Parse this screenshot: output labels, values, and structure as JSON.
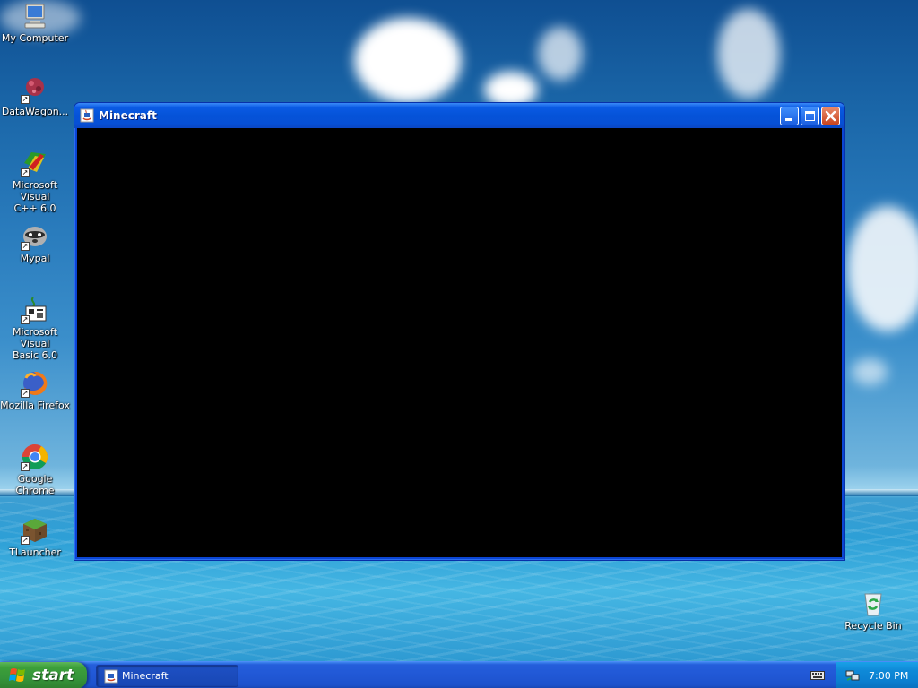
{
  "desktop": {
    "icons": [
      {
        "label": "My Computer",
        "icon": "my-computer-icon",
        "shortcut": false
      },
      {
        "label": "DataWagon...",
        "icon": "datawagon-icon",
        "shortcut": true
      },
      {
        "label": "Microsoft Visual\nC++ 6.0",
        "icon": "visual-cpp-icon",
        "shortcut": true
      },
      {
        "label": "Mypal",
        "icon": "mypal-icon",
        "shortcut": true
      },
      {
        "label": "Microsoft Visual\nBasic 6.0",
        "icon": "visual-basic-icon",
        "shortcut": true
      },
      {
        "label": "Mozilla Firefox",
        "icon": "firefox-icon",
        "shortcut": true
      },
      {
        "label": "Google Chrome",
        "icon": "chrome-icon",
        "shortcut": true
      },
      {
        "label": "TLauncher",
        "icon": "tlauncher-icon",
        "shortcut": true
      }
    ],
    "recycle_bin": {
      "label": "Recycle Bin",
      "icon": "recycle-bin-icon"
    }
  },
  "window": {
    "title": "Minecraft",
    "icon": "java-icon",
    "client_color": "#000000",
    "buttons": [
      "minimize",
      "maximize",
      "close"
    ]
  },
  "taskbar": {
    "start_label": "start",
    "tasks": [
      {
        "label": "Minecraft",
        "icon": "java-icon"
      }
    ],
    "clock": "7:00 PM"
  },
  "colors": {
    "titlebar_blue": "#0553d8",
    "taskbar_blue": "#245edb",
    "start_green": "#3c9f3a",
    "close_red": "#c9441e"
  }
}
